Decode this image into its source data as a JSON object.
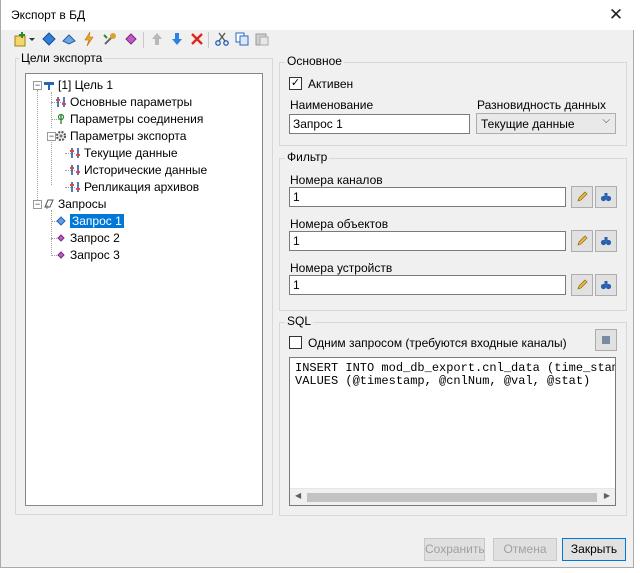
{
  "window": {
    "title": "Экспорт в БД",
    "close_glyph": "✕"
  },
  "toolbar": {
    "icons": [
      "add-target-icon",
      "dropdown-arrow-icon",
      "add-item-icon",
      "add-item-2-icon",
      "lightning-icon",
      "tools-icon",
      "gem-icon",
      "move-up-icon",
      "move-down-icon",
      "delete-icon",
      "cut-icon",
      "copy-icon",
      "paste-icon"
    ]
  },
  "tree": {
    "group_title": "Цели экспорта",
    "nodes": [
      {
        "label": "[1] Цель 1",
        "icon": "target-icon"
      },
      {
        "label": "Основные параметры",
        "icon": "settings-icon"
      },
      {
        "label": "Параметры соединения",
        "icon": "connection-icon"
      },
      {
        "label": "Параметры экспорта",
        "icon": "gear-icon"
      },
      {
        "label": "Текущие данные",
        "icon": "settings-icon"
      },
      {
        "label": "Исторические данные",
        "icon": "settings-icon"
      },
      {
        "label": "Репликация архивов",
        "icon": "settings-icon"
      },
      {
        "label": "Запросы",
        "icon": "queries-icon"
      },
      {
        "label": "Запрос 1",
        "icon": "query-icon"
      },
      {
        "label": "Запрос 2",
        "icon": "query-icon"
      },
      {
        "label": "Запрос 3",
        "icon": "query-icon"
      }
    ],
    "expander_glyph": "−"
  },
  "general": {
    "group_title": "Основное",
    "active_label": "Активен",
    "active_check": "✓",
    "name_label": "Наименование",
    "name_value": "Запрос 1",
    "datakind_label": "Разновидность данных",
    "datakind_value": "Текущие данные",
    "dropdown_glyph": "⌵"
  },
  "filter": {
    "group_title": "Фильтр",
    "channels_label": "Номера каналов",
    "channels_value": "1",
    "objects_label": "Номера объектов",
    "objects_value": "1",
    "devices_label": "Номера устройств",
    "devices_value": "1"
  },
  "sql": {
    "group_title": "SQL",
    "single_query_label": "Одним запросом (требуются входные каналы)",
    "text": "INSERT INTO mod_db_export.cnl_data (time_stam\nVALUES (@timestamp, @cnlNum, @val, @stat)",
    "scroll_left": "◀",
    "scroll_right": "▶"
  },
  "buttons": {
    "save": "Сохранить",
    "cancel": "Отмена",
    "close": "Закрыть"
  },
  "colors": {
    "selection": "#0078d7",
    "accent_blue": "#1a6fd8"
  }
}
